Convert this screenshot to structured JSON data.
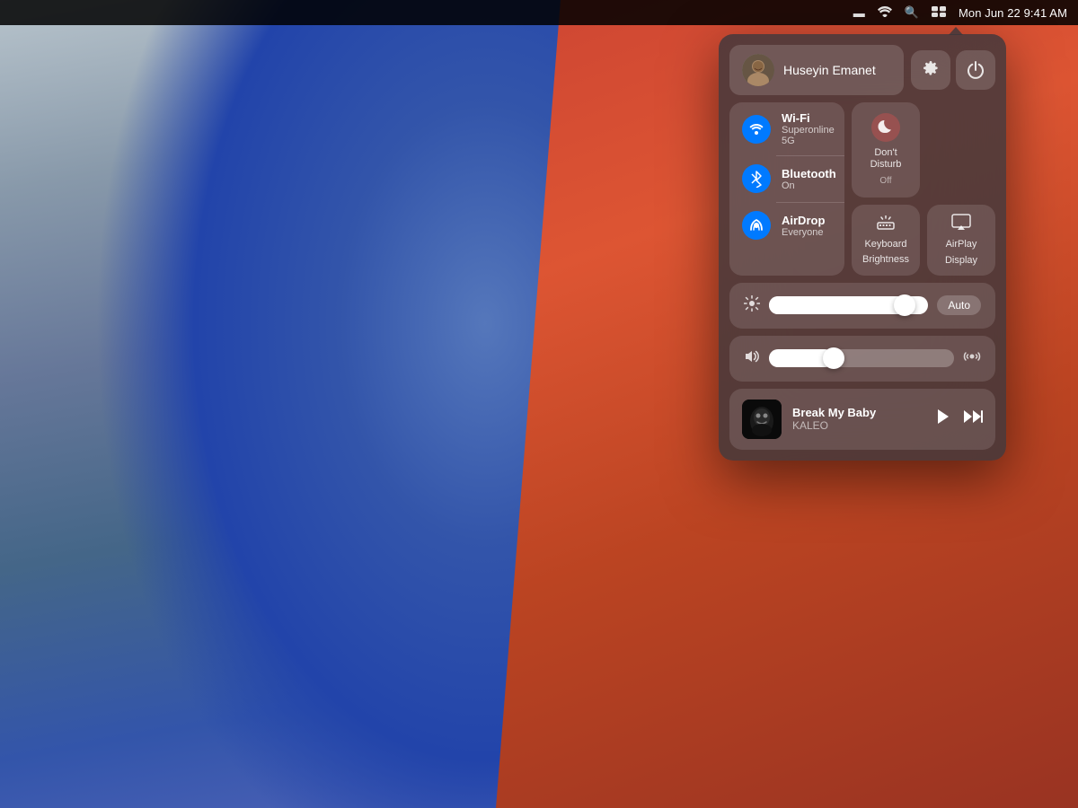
{
  "desktop": {
    "bg_description": "macOS Big Sur wallpaper"
  },
  "menubar": {
    "datetime": "Mon Jun 22  9:41 AM",
    "battery_icon": "🔋",
    "wifi_icon": "wifi",
    "search_icon": "🔍",
    "control_center_icon": "⊞"
  },
  "control_center": {
    "user": {
      "name": "Huseyin Emanet",
      "avatar_emoji": "👤"
    },
    "system_prefs_icon": "⚙",
    "power_icon": "⏻",
    "wifi": {
      "title": "Wi-Fi",
      "subtitle": "Superonline 5G",
      "enabled": true
    },
    "bluetooth": {
      "title": "Bluetooth",
      "subtitle": "On",
      "enabled": true
    },
    "airdrop": {
      "title": "AirDrop",
      "subtitle": "Everyone",
      "enabled": true
    },
    "dont_disturb": {
      "title": "Don't Disturb",
      "subtitle": "Off"
    },
    "keyboard_brightness": {
      "line1": "Keyboard",
      "line2": "Brightness"
    },
    "airplay_display": {
      "line1": "AirPlay",
      "line2": "Display"
    },
    "display_slider": {
      "value": 85,
      "auto_label": "Auto"
    },
    "volume_slider": {
      "value": 35
    },
    "now_playing": {
      "title": "Break My Baby",
      "artist": "KALEO",
      "play_icon": "▶",
      "ff_icon": "⏭"
    }
  }
}
